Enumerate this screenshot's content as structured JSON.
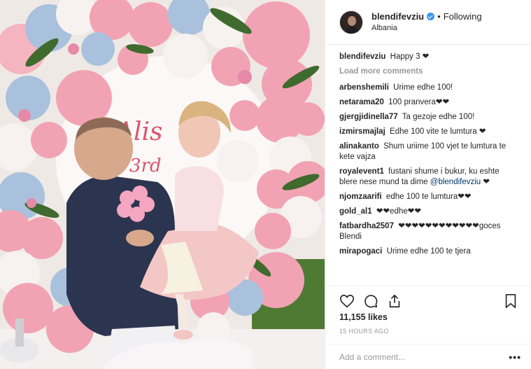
{
  "header": {
    "username": "blendifevziu",
    "follow_label": "Following",
    "dot": "•",
    "location": "Albania"
  },
  "caption": {
    "username": "blendifevziu",
    "text": "Happy 3 ❤"
  },
  "load_more": "Load more comments",
  "comments": [
    {
      "user": "arbenshemili",
      "text": "Urime edhe 100!"
    },
    {
      "user": "netarama20",
      "text": "100 pranvera❤❤"
    },
    {
      "user": "gjergjidinella77",
      "text": "Ta gezoje edhe 100!"
    },
    {
      "user": "izmirsmajlaj",
      "text": "Edhe 100 vite te lumtura ❤"
    },
    {
      "user": "alinakanto",
      "text": "Shum uriime 100 vjet te lumtura te kete vajza"
    },
    {
      "user": "royalevent1",
      "text": "fustani shume i bukur, ku eshte blere nese mund ta dime",
      "mention": "@blendifevziu",
      "after": " ❤"
    },
    {
      "user": "njomzaarifi",
      "text": "edhe 100 te lumtura❤❤"
    },
    {
      "user": "gold_al1",
      "text": "❤❤edhe❤❤"
    },
    {
      "user": "fatbardha2507",
      "text": "❤❤❤❤❤❤❤❤❤❤❤❤goces Blendi"
    },
    {
      "user": "mirapogaci",
      "text": "Urime edhe 100 te tjera"
    }
  ],
  "icons": {
    "like": "heart-icon",
    "comment": "comment-icon",
    "share": "share-icon",
    "save": "bookmark-icon",
    "verified": "verified-badge-icon"
  },
  "likes": "11,155 likes",
  "timestamp": "15 HOURS AGO",
  "add_comment_placeholder": "Add a comment...",
  "more_label": "•••",
  "colors": {
    "link_blue": "#003569",
    "verified_blue": "#3897f0",
    "muted": "#999999",
    "balloon_pink": "#f2a3b3",
    "balloon_blue": "#a9c1dc"
  }
}
